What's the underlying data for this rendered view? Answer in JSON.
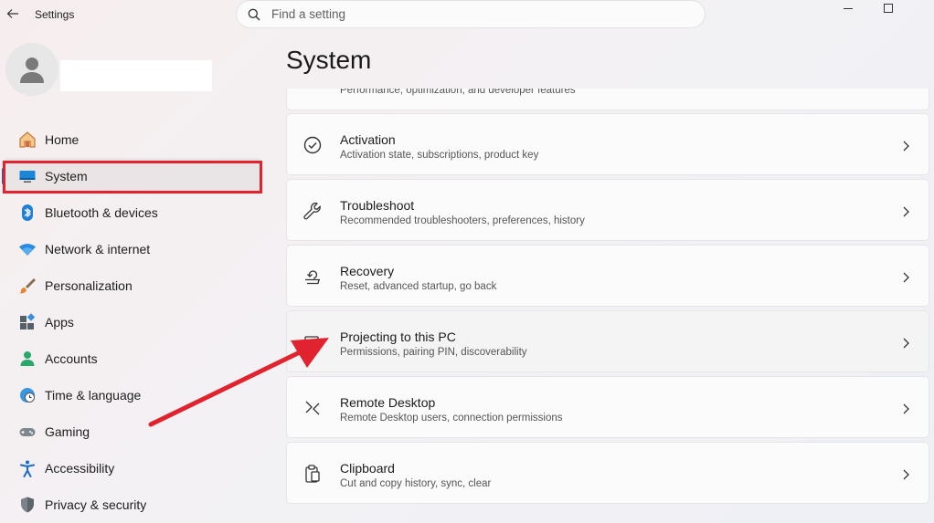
{
  "window": {
    "title": "Settings"
  },
  "search": {
    "placeholder": "Find a setting"
  },
  "page": {
    "title": "System"
  },
  "nav": {
    "items": [
      {
        "label": "Home",
        "icon": "home-icon"
      },
      {
        "label": "System",
        "icon": "monitor-icon",
        "selected": true
      },
      {
        "label": "Bluetooth & devices",
        "icon": "bluetooth-icon"
      },
      {
        "label": "Network & internet",
        "icon": "wifi-icon"
      },
      {
        "label": "Personalization",
        "icon": "brush-icon"
      },
      {
        "label": "Apps",
        "icon": "apps-icon"
      },
      {
        "label": "Accounts",
        "icon": "person-icon"
      },
      {
        "label": "Time & language",
        "icon": "clock-globe-icon"
      },
      {
        "label": "Gaming",
        "icon": "gamepad-icon"
      },
      {
        "label": "Accessibility",
        "icon": "accessibility-icon"
      },
      {
        "label": "Privacy & security",
        "icon": "shield-icon"
      }
    ]
  },
  "cards": [
    {
      "title": "",
      "subtitle": "Performance, optimization, and developer features",
      "icon": ""
    },
    {
      "title": "Activation",
      "subtitle": "Activation state, subscriptions, product key",
      "icon": "check-circle-icon"
    },
    {
      "title": "Troubleshoot",
      "subtitle": "Recommended troubleshooters, preferences, history",
      "icon": "wrench-icon"
    },
    {
      "title": "Recovery",
      "subtitle": "Reset, advanced startup, go back",
      "icon": "recovery-icon"
    },
    {
      "title": "Projecting to this PC",
      "subtitle": "Permissions, pairing PIN, discoverability",
      "icon": "projecting-icon"
    },
    {
      "title": "Remote Desktop",
      "subtitle": "Remote Desktop users, connection permissions",
      "icon": "remote-desktop-icon"
    },
    {
      "title": "Clipboard",
      "subtitle": "Cut and copy history, sync, clear",
      "icon": "clipboard-icon"
    }
  ],
  "colors": {
    "accent": "#0067c0",
    "annotation": "#e0232e"
  }
}
